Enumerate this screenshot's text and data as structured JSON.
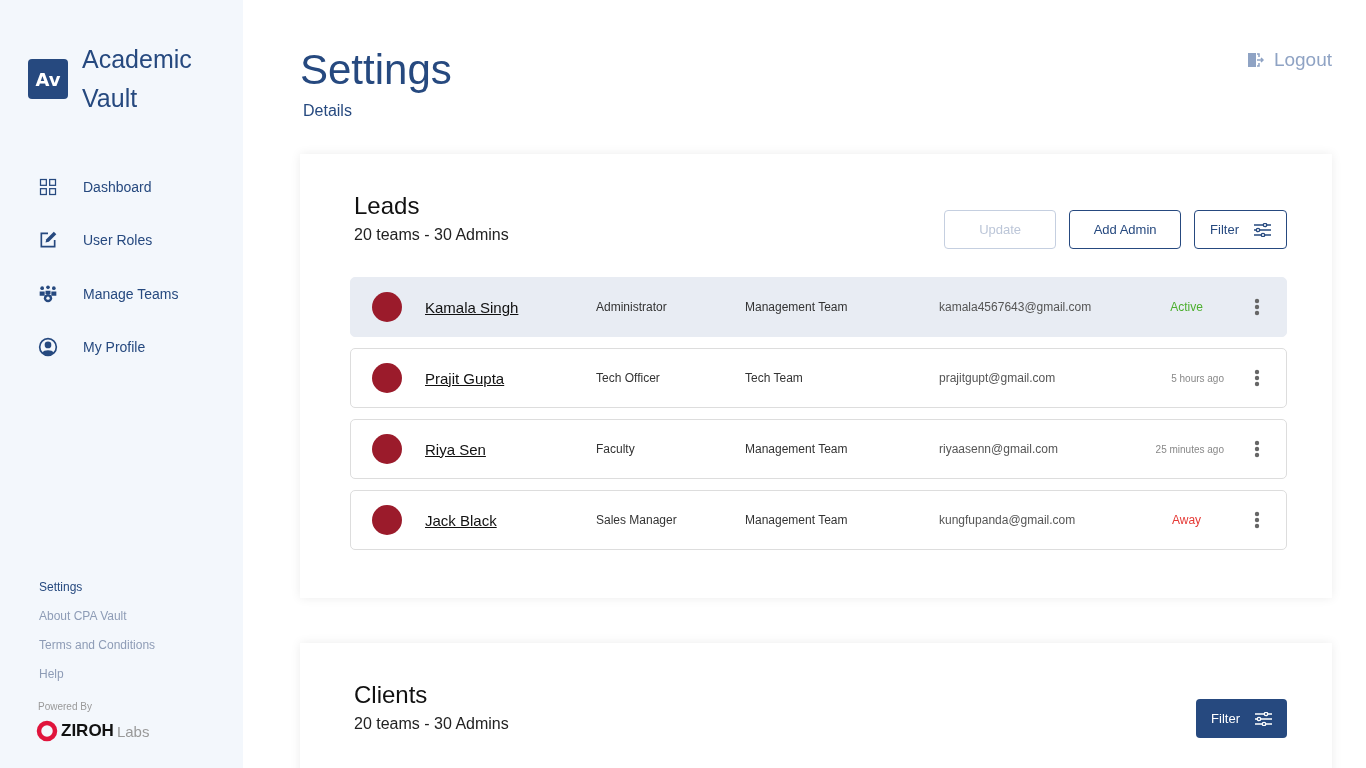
{
  "sidebar": {
    "logo": {
      "mark": "Av",
      "name": "Academic Vault"
    },
    "nav": [
      {
        "label": "Dashboard"
      },
      {
        "label": "User Roles"
      },
      {
        "label": "Manage Teams"
      },
      {
        "label": "My Profile"
      }
    ],
    "footer_links": [
      {
        "label": "Settings",
        "selected": true
      },
      {
        "label": "About CPA Vault",
        "selected": false
      },
      {
        "label": "Terms and Conditions",
        "selected": false
      },
      {
        "label": "Help",
        "selected": false
      }
    ],
    "powered_by": "Powered By",
    "brand": {
      "name": "ZIROH",
      "suffix": "Labs"
    }
  },
  "header": {
    "title": "Settings",
    "subtitle": "Details",
    "logout": "Logout"
  },
  "sections": [
    {
      "title": "Leads",
      "summary": "20 teams - 30 Admins",
      "buttons": [
        {
          "label": "Update",
          "kind": "plain",
          "disabled": true
        },
        {
          "label": "Add Admin",
          "kind": "plain",
          "disabled": false
        },
        {
          "label": "Filter",
          "kind": "filter",
          "disabled": false
        }
      ],
      "rows": [
        {
          "name": "Kamala Singh",
          "role": "Administrator",
          "team": "Management Team",
          "email": "kamala4567643@gmail.com",
          "status": {
            "kind": "active",
            "text": "Active"
          },
          "selected": true
        },
        {
          "name": "Prajit Gupta",
          "role": "Tech Officer",
          "team": "Tech Team",
          "email": "prajitgupt@gmail.com",
          "status": {
            "kind": "time",
            "text": "5 hours ago"
          },
          "selected": false
        },
        {
          "name": "Riya Sen",
          "role": "Faculty",
          "team": "Management Team",
          "email": "riyaasenn@gmail.com",
          "status": {
            "kind": "time",
            "text": "25 minutes ago"
          },
          "selected": false
        },
        {
          "name": "Jack Black",
          "role": "Sales Manager",
          "team": "Management Team",
          "email": "kungfupanda@gmail.com",
          "status": {
            "kind": "away",
            "text": "Away"
          },
          "selected": false
        }
      ]
    },
    {
      "title": "Clients",
      "summary": "20 teams - 30 Admins",
      "buttons": [
        {
          "label": "Filter",
          "kind": "filter-solid"
        }
      ]
    }
  ]
}
